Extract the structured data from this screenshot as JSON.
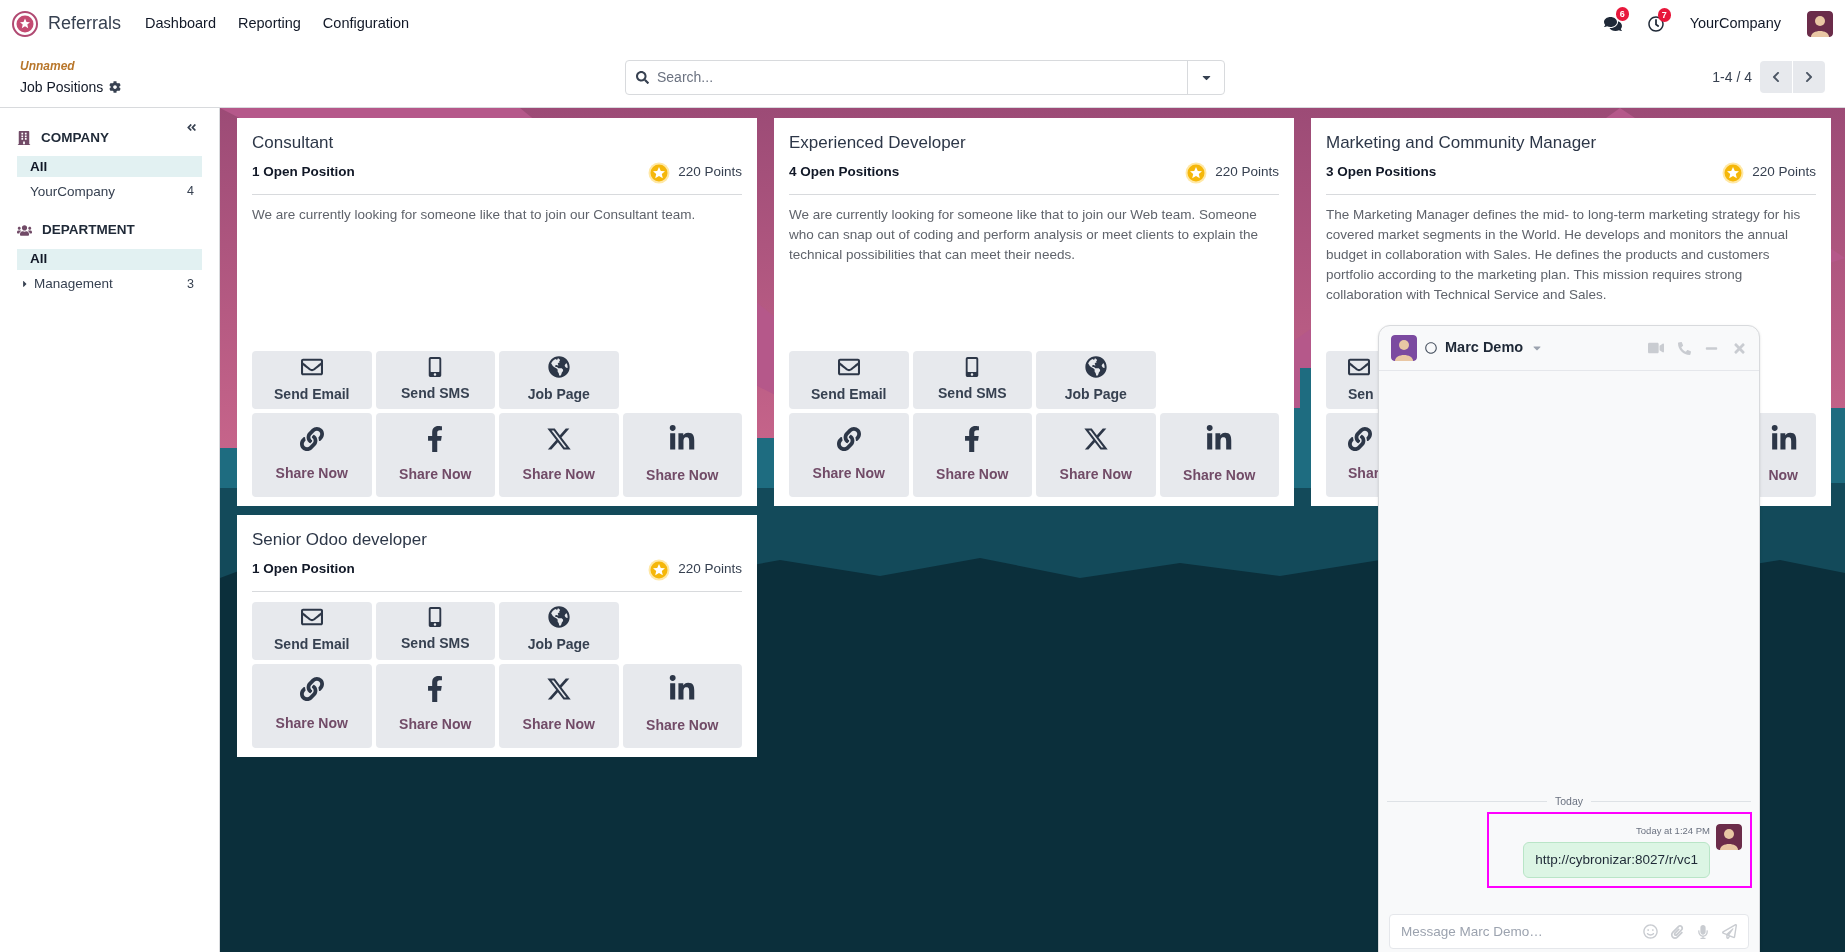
{
  "app": {
    "name": "Referrals",
    "menu": [
      "Dashboard",
      "Reporting",
      "Configuration"
    ]
  },
  "systray": {
    "messages_badge": "6",
    "activities_badge": "7",
    "company": "YourCompany"
  },
  "breadcrumb": {
    "parent": "Unnamed",
    "current": "Job Positions"
  },
  "search": {
    "placeholder": "Search..."
  },
  "pager": {
    "range": "1-4 / 4"
  },
  "sidebar": {
    "sections": [
      {
        "kind": "company",
        "title": "COMPANY",
        "items": [
          {
            "kind": "value",
            "label": "All",
            "selected": true
          },
          {
            "kind": "value",
            "label": "YourCompany",
            "count": "4",
            "selected": false
          }
        ]
      },
      {
        "kind": "department",
        "title": "DEPARTMENT",
        "items": [
          {
            "kind": "value",
            "label": "All",
            "selected": true
          },
          {
            "kind": "group",
            "label": "Management",
            "count": "3",
            "expanded": false,
            "selected": false
          }
        ]
      }
    ]
  },
  "cards": [
    {
      "title": "Consultant",
      "positions": "1 Open Position",
      "points": "220 Points",
      "description": "We are currently looking for someone like that to join our Consultant team.",
      "actions": [
        {
          "kind": "email",
          "label": "Send Email"
        },
        {
          "kind": "sms",
          "label": "Send SMS"
        },
        {
          "kind": "web",
          "label": "Job Page"
        }
      ],
      "shares": [
        {
          "kind": "link",
          "label": "Share Now"
        },
        {
          "kind": "facebook",
          "label": "Share Now"
        },
        {
          "kind": "x",
          "label": "Share Now"
        },
        {
          "kind": "linkedin",
          "label": "Share Now"
        }
      ]
    },
    {
      "title": "Experienced Developer",
      "positions": "4 Open Positions",
      "points": "220 Points",
      "description": "We are currently looking for someone like that to join our Web team. Someone who can snap out of coding and perform analysis or meet clients to explain the technical possibilities that can meet their needs.",
      "actions": [
        {
          "kind": "email",
          "label": "Send Email"
        },
        {
          "kind": "sms",
          "label": "Send SMS"
        },
        {
          "kind": "web",
          "label": "Job Page"
        }
      ],
      "shares": [
        {
          "kind": "link",
          "label": "Share Now"
        },
        {
          "kind": "facebook",
          "label": "Share Now"
        },
        {
          "kind": "x",
          "label": "Share Now"
        },
        {
          "kind": "linkedin",
          "label": "Share Now"
        }
      ]
    },
    {
      "title": "Marketing and Community Manager",
      "positions": "3 Open Positions",
      "points": "220 Points",
      "description": "The Marketing Manager defines the mid- to long-term marketing strategy for his covered market segments in the World. He develops and monitors the annual budget in collaboration with Sales. He defines the products and customers portfolio according to the marketing plan. This mission requires strong collaboration with Technical Service and Sales.",
      "actions": [
        {
          "kind": "email",
          "label": "Sen",
          "covered_left": false
        }
      ],
      "shares": [
        {
          "kind": "link",
          "label": "Shar",
          "covered_left": false
        },
        {
          "kind": "linkedin",
          "label": "Now",
          "covered_left": true
        }
      ]
    },
    {
      "title": "Senior Odoo developer",
      "positions": "1 Open Position",
      "points": "220 Points",
      "actions": [
        {
          "kind": "email",
          "label": "Send Email"
        },
        {
          "kind": "sms",
          "label": "Send SMS"
        },
        {
          "kind": "web",
          "label": "Job Page"
        }
      ],
      "shares": [
        {
          "kind": "link",
          "label": "Share Now"
        },
        {
          "kind": "facebook",
          "label": "Share Now"
        },
        {
          "kind": "x",
          "label": "Share Now"
        },
        {
          "kind": "linkedin",
          "label": "Share Now"
        }
      ]
    }
  ],
  "chat": {
    "contact": "Marc Demo",
    "day": "Today",
    "messages": [
      {
        "time": "Today at 1:24 PM",
        "text": "http://cybronizar:8027/r/vc1",
        "highlighted": true
      }
    ],
    "composer": {
      "placeholder": "Message Marc Demo…"
    }
  }
}
